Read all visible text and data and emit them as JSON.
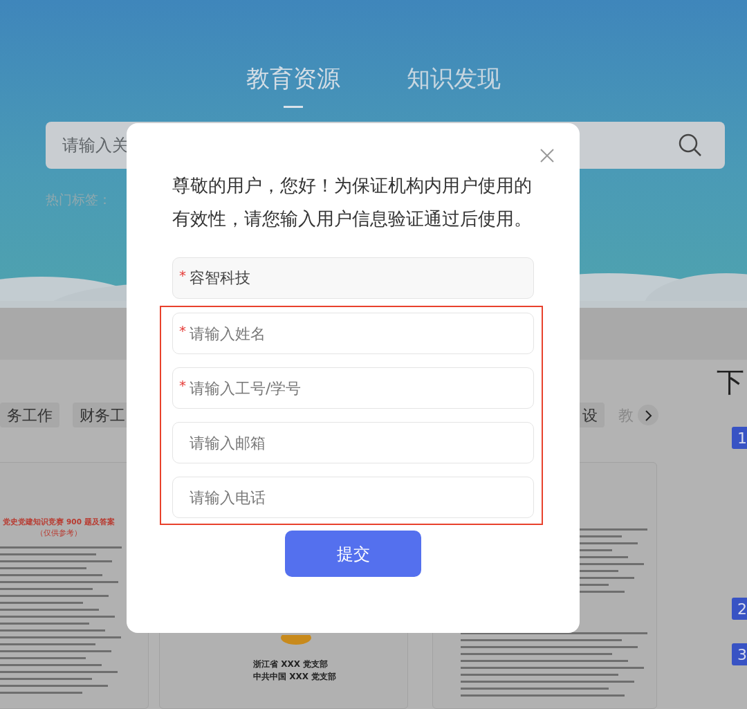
{
  "header_tabs": [
    {
      "label": "教育资源",
      "selected": true
    },
    {
      "label": "知识发现",
      "selected": false
    }
  ],
  "search": {
    "placeholder": "请输入关"
  },
  "hot_tags_label": "热门标签：",
  "category_tags": [
    {
      "label": "务工作",
      "faded": false
    },
    {
      "label": "财务工",
      "faded": false
    },
    {
      "label": "设",
      "faded": false
    },
    {
      "label": "教",
      "faded": true
    }
  ],
  "documents": [
    {
      "kind": "quiz",
      "title": "党史党建知识竞赛 900 题及答案",
      "subtitle": "（仅供参考）"
    },
    {
      "kind": "notice",
      "lines": [
        "浙江省 XXX 党支部",
        "中共中国 XXX 党支部"
      ]
    },
    {
      "kind": "text"
    }
  ],
  "side_heading": "下",
  "ranks": [
    "1",
    "2",
    "3"
  ],
  "modal": {
    "message": "尊敬的用户，您好！为保证机构内用户使用的有效性，请您输入用户信息验证通过后使用。",
    "fields": [
      {
        "marker": "*",
        "value": "容智科技"
      }
    ],
    "highlight_frame": {
      "fields": [
        {
          "marker": "*",
          "placeholder": "请输入姓名"
        },
        {
          "marker": "*",
          "placeholder": "请输入工号/学号"
        },
        {
          "placeholder": "请输入邮箱"
        },
        {
          "placeholder": "请输入电话"
        }
      ]
    },
    "submit": "提交"
  }
}
